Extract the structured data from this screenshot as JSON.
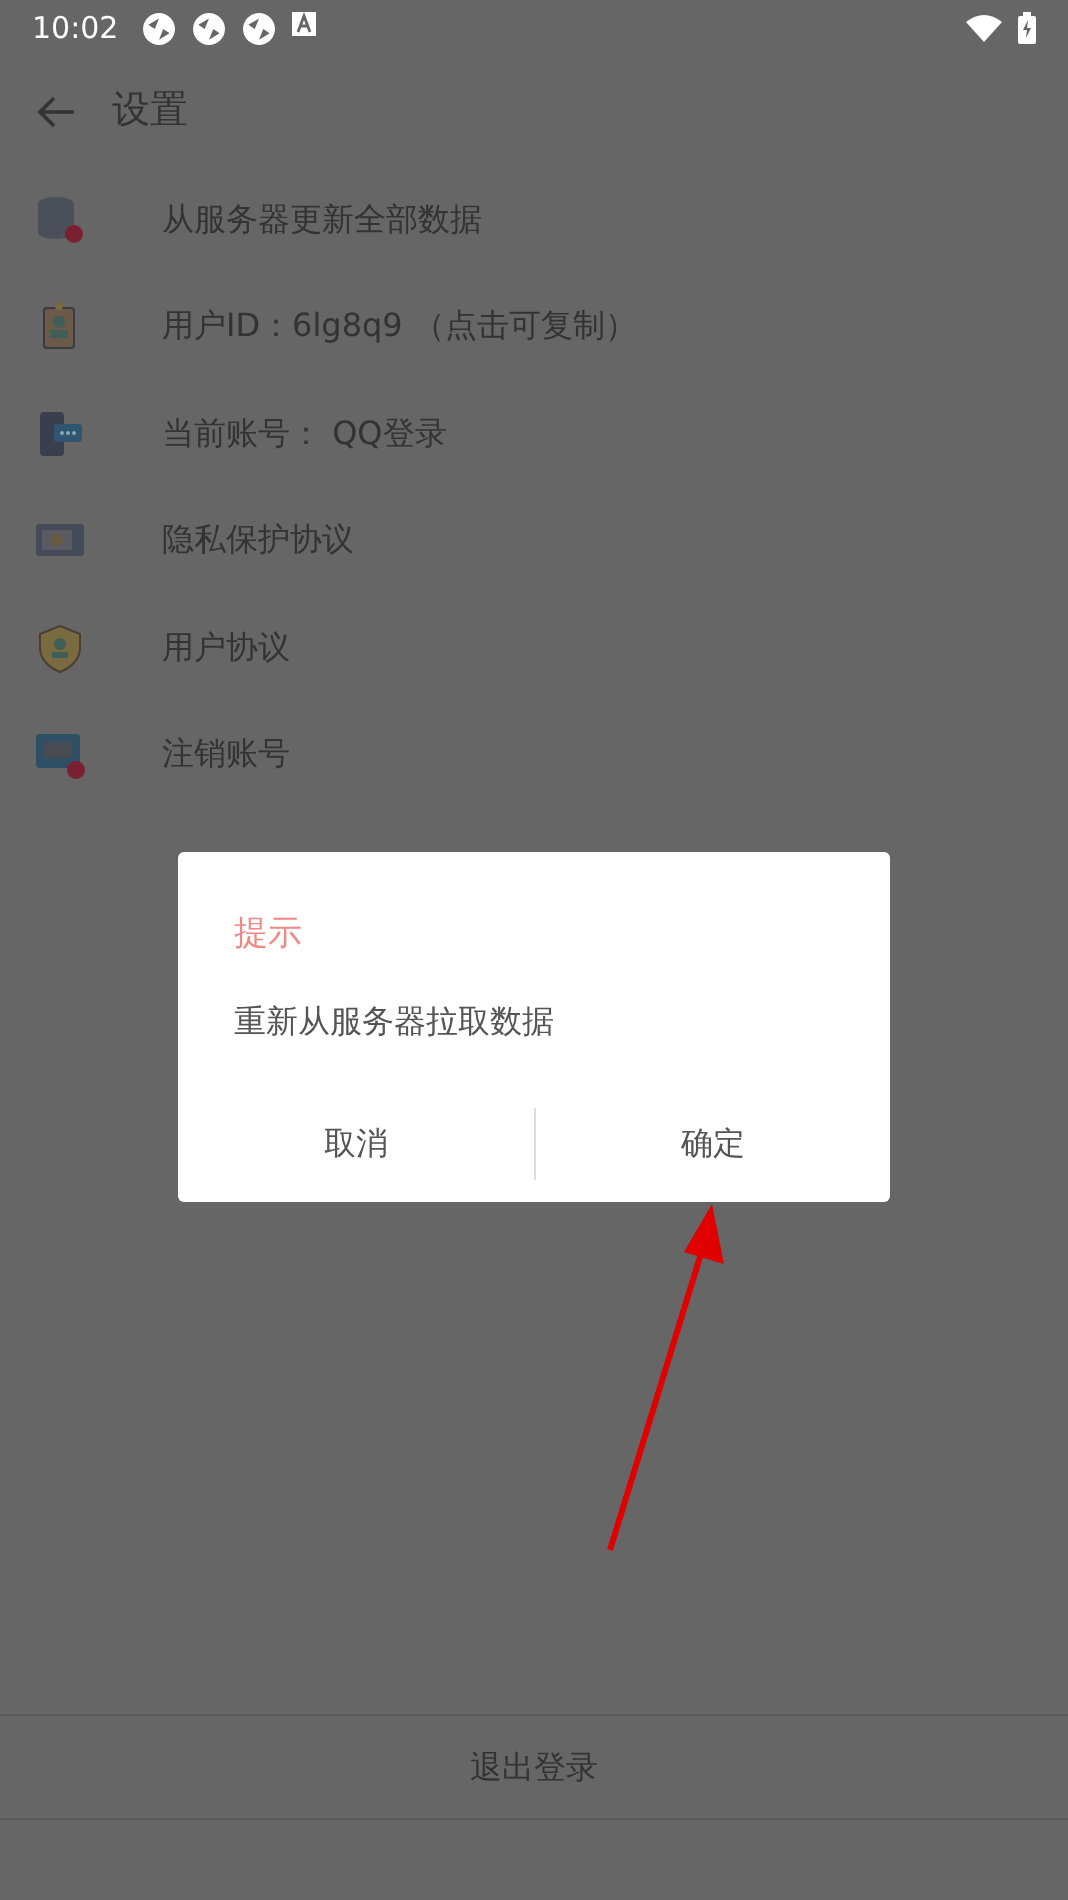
{
  "status_bar": {
    "time": "10:02"
  },
  "header": {
    "title": "设置"
  },
  "items": [
    {
      "label": "从服务器更新全部数据",
      "kind": "database"
    },
    {
      "label": "用户ID：6lg8q9 （点击可复制）",
      "kind": "badge"
    },
    {
      "label": "当前账号： QQ登录",
      "kind": "phone"
    },
    {
      "label": "隐私保护协议",
      "kind": "safe"
    },
    {
      "label": "用户协议",
      "kind": "shield"
    },
    {
      "label": "注销账号",
      "kind": "monitor"
    }
  ],
  "logout": {
    "label": "退出登录"
  },
  "dialog": {
    "title": "提示",
    "message": "重新从服务器拉取数据",
    "buttons": [
      "取消",
      "确定"
    ]
  }
}
